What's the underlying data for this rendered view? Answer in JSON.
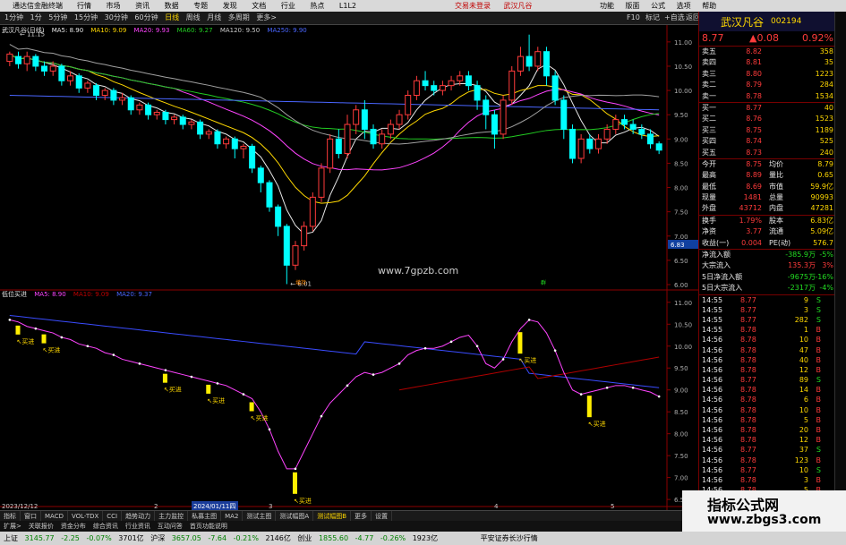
{
  "titlebar": {
    "app_name": "通达信金融终端",
    "menu": [
      "行情",
      "市场",
      "资讯",
      "数据",
      "专题",
      "发现",
      "文档",
      "行业",
      "热点",
      "L1L2"
    ],
    "center_links": [
      "交易未登录",
      "武汉凡谷"
    ],
    "right_items": [
      "功能",
      "版面",
      "公式",
      "选项",
      "帮助"
    ]
  },
  "toolbar": {
    "periods": [
      "1分钟",
      "1分",
      "5分钟",
      "15分钟",
      "30分钟",
      "60分钟",
      "日线",
      "周线",
      "月线",
      "多周期",
      "更多>"
    ],
    "selected": "日线",
    "right_items": [
      "F10",
      "标记",
      "+自选",
      "返回"
    ]
  },
  "main_chart": {
    "title": "武汉凡谷(日线)",
    "legend": [
      {
        "text": "MA5: 8.90",
        "color": "#e8e8e8"
      },
      {
        "text": "MA10: 9.09",
        "color": "#ffd800"
      },
      {
        "text": "MA20: 9.93",
        "color": "#ff44ff"
      },
      {
        "text": "MA60: 9.27",
        "color": "#22cc22"
      },
      {
        "text": "MA120: 9.50",
        "color": "#cccccc"
      },
      {
        "text": "MA250: 9.90",
        "color": "#4a66ff"
      }
    ],
    "y_ticks": [
      "11.00",
      "10.50",
      "10.00",
      "9.50",
      "9.00",
      "8.50",
      "8.00",
      "7.50",
      "7.00",
      "6.50",
      "6.00"
    ],
    "price_tag": "6.83",
    "high_label": "11.15",
    "low_label": "6.01",
    "watermark": "www.7gpzb.com",
    "marker_a": "增持",
    "marker_b": "群"
  },
  "sub_chart": {
    "title": "低位买进",
    "legend": [
      {
        "text": "MA5: 8.90",
        "color": "#ff44ff"
      },
      {
        "text": "MA10: 9.09",
        "color": "#c00000"
      },
      {
        "text": "MA20: 9.37",
        "color": "#4a66ff"
      }
    ],
    "y_ticks": [
      "11.00",
      "10.50",
      "10.00",
      "9.50",
      "9.00",
      "8.50",
      "8.00",
      "7.50",
      "7.00",
      "6.50"
    ],
    "signal_label": "买进",
    "signals_count": 8
  },
  "x_axis": {
    "left_date": "2023/12/12",
    "selected_date": "2024/01/11四",
    "ticks": [
      "2",
      "3",
      "4",
      "5"
    ]
  },
  "quote": {
    "name": "武汉凡谷",
    "code": "002194",
    "price": "8.77",
    "change": "▲0.08",
    "pct": "0.92%",
    "asks": [
      {
        "label": "卖五",
        "price": "8.82",
        "vol": "358"
      },
      {
        "label": "卖四",
        "price": "8.81",
        "vol": "35"
      },
      {
        "label": "卖三",
        "price": "8.80",
        "vol": "1223"
      },
      {
        "label": "卖二",
        "price": "8.79",
        "vol": "284"
      },
      {
        "label": "卖一",
        "price": "8.78",
        "vol": "1534"
      }
    ],
    "bids": [
      {
        "label": "买一",
        "price": "8.77",
        "vol": "40"
      },
      {
        "label": "买二",
        "price": "8.76",
        "vol": "1523"
      },
      {
        "label": "买三",
        "price": "8.75",
        "vol": "1189"
      },
      {
        "label": "买四",
        "price": "8.74",
        "vol": "525"
      },
      {
        "label": "买五",
        "price": "8.73",
        "vol": "240"
      }
    ],
    "stats": [
      {
        "k1": "今开",
        "v1": "8.75",
        "k2": "均价",
        "v2": "8.79"
      },
      {
        "k1": "最高",
        "v1": "8.89",
        "k2": "量比",
        "v2": "0.65"
      },
      {
        "k1": "最低",
        "v1": "8.69",
        "k2": "市值",
        "v2": "59.9亿"
      },
      {
        "k1": "现量",
        "v1": "1481",
        "k2": "总量",
        "v2": "90993"
      },
      {
        "k1": "外盘",
        "v1": "43712",
        "k2": "内盘",
        "v2": "47281"
      }
    ],
    "stats2": [
      {
        "k1": "换手",
        "v1": "1.79%",
        "k2": "股本",
        "v2": "6.83亿"
      },
      {
        "k1": "净资",
        "v1": "3.77",
        "k2": "流通",
        "v2": "5.09亿"
      },
      {
        "k1": "收益(一)",
        "v1": "0.004",
        "k2": "PE(动)",
        "v2": "576.7"
      }
    ],
    "flows": [
      {
        "label": "净流入额",
        "value": "-385.9万",
        "pct": "-5%"
      },
      {
        "label": "大宗流入",
        "value": "135.3万",
        "pct": "3%"
      },
      {
        "label": "5日净流入额",
        "value": "-9675万",
        "pct": "-16%"
      },
      {
        "label": "5日大宗流入",
        "value": "-2317万",
        "pct": "-4%"
      }
    ],
    "ticks": [
      {
        "t": "14:55",
        "p": "8.77",
        "v": "9",
        "s": "S"
      },
      {
        "t": "14:55",
        "p": "8.77",
        "v": "3",
        "s": "S"
      },
      {
        "t": "14:55",
        "p": "8.77",
        "v": "282",
        "s": "S"
      },
      {
        "t": "14:55",
        "p": "8.78",
        "v": "1",
        "s": "B"
      },
      {
        "t": "14:56",
        "p": "8.78",
        "v": "10",
        "s": "B"
      },
      {
        "t": "14:56",
        "p": "8.78",
        "v": "47",
        "s": "B"
      },
      {
        "t": "14:56",
        "p": "8.78",
        "v": "40",
        "s": "B"
      },
      {
        "t": "14:56",
        "p": "8.78",
        "v": "12",
        "s": "B"
      },
      {
        "t": "14:56",
        "p": "8.77",
        "v": "89",
        "s": "S"
      },
      {
        "t": "14:56",
        "p": "8.78",
        "v": "14",
        "s": "B"
      },
      {
        "t": "14:56",
        "p": "8.78",
        "v": "6",
        "s": "B"
      },
      {
        "t": "14:56",
        "p": "8.78",
        "v": "10",
        "s": "B"
      },
      {
        "t": "14:56",
        "p": "8.78",
        "v": "5",
        "s": "B"
      },
      {
        "t": "14:56",
        "p": "8.78",
        "v": "20",
        "s": "B"
      },
      {
        "t": "14:56",
        "p": "8.78",
        "v": "12",
        "s": "B"
      },
      {
        "t": "14:56",
        "p": "8.77",
        "v": "37",
        "s": "S"
      },
      {
        "t": "14:56",
        "p": "8.78",
        "v": "123",
        "s": "B"
      },
      {
        "t": "14:56",
        "p": "8.77",
        "v": "10",
        "s": "S"
      },
      {
        "t": "14:56",
        "p": "8.78",
        "v": "3",
        "s": "B"
      },
      {
        "t": "14:56",
        "p": "8.78",
        "v": "5",
        "s": "B"
      }
    ]
  },
  "tabbar": {
    "items": [
      "指标",
      "窗口",
      "MACD",
      "VOL-TDX",
      "CCI",
      "趋势动力",
      "主力监控",
      "私募主图",
      "MA2",
      "测试主图",
      "测试幅图A",
      "测试幅图B",
      "更多",
      "设置"
    ],
    "selected": "测试幅图B"
  },
  "indexbar": {
    "items": [
      "扩展>",
      "关联报价",
      "资金分布",
      "综合资讯",
      "行业资讯",
      "互动问答",
      "首页功能说明"
    ]
  },
  "status": {
    "sh_label": "上证",
    "sh_val": "3145.77",
    "sh_chg": "-2.25",
    "sh_pct": "-0.07%",
    "sh_amt": "3701亿",
    "sz_label": "沪深",
    "sz_val": "3657.05",
    "sz_chg": "-7.64",
    "sz_pct": "-0.21%",
    "sz_amt": "2146亿",
    "cy_label": "创业",
    "cy_val": "1855.60",
    "cy_chg": "-4.77",
    "cy_pct": "-0.26%",
    "cy_amt": "1923亿",
    "broker": "平安证券长沙行情"
  },
  "badge": {
    "title": "指标公式网",
    "url": "www.zbgs3.com"
  },
  "chart_data": {
    "type": "candlestick",
    "title": "武汉凡谷(日线)",
    "ylim": [
      6.0,
      11.2
    ],
    "candles": [
      [
        10.6,
        10.75,
        10.5,
        10.8
      ],
      [
        10.7,
        10.55,
        10.45,
        10.8
      ],
      [
        10.55,
        10.7,
        10.4,
        10.8
      ],
      [
        10.7,
        10.5,
        10.4,
        10.75
      ],
      [
        10.5,
        10.4,
        10.3,
        10.6
      ],
      [
        10.4,
        10.5,
        10.3,
        10.6
      ],
      [
        10.5,
        10.2,
        10.1,
        10.55
      ],
      [
        10.2,
        10.3,
        10.1,
        10.4
      ],
      [
        10.3,
        10.05,
        9.95,
        10.35
      ],
      [
        10.05,
        10.15,
        9.95,
        10.2
      ],
      [
        10.1,
        9.9,
        9.8,
        10.15
      ],
      [
        9.9,
        10.0,
        9.8,
        10.05
      ],
      [
        10.0,
        9.8,
        9.7,
        10.05
      ],
      [
        9.8,
        9.85,
        9.7,
        9.95
      ],
      [
        9.85,
        9.6,
        9.5,
        9.9
      ],
      [
        9.6,
        9.7,
        9.5,
        9.75
      ],
      [
        9.7,
        9.5,
        9.4,
        9.75
      ],
      [
        9.5,
        9.55,
        9.4,
        9.6
      ],
      [
        9.55,
        9.4,
        9.3,
        9.6
      ],
      [
        9.4,
        9.45,
        9.3,
        9.5
      ],
      [
        9.45,
        9.3,
        9.2,
        9.5
      ],
      [
        9.3,
        9.35,
        9.2,
        9.4
      ],
      [
        9.35,
        9.1,
        9.0,
        9.4
      ],
      [
        9.1,
        9.15,
        9.0,
        9.2
      ],
      [
        9.15,
        8.9,
        8.8,
        9.2
      ],
      [
        8.9,
        9.0,
        8.8,
        9.05
      ],
      [
        9.0,
        8.8,
        8.6,
        9.05
      ],
      [
        8.8,
        8.85,
        8.6,
        8.9
      ],
      [
        8.85,
        8.4,
        8.3,
        8.9
      ],
      [
        8.4,
        8.1,
        7.9,
        8.45
      ],
      [
        8.1,
        7.6,
        7.5,
        8.15
      ],
      [
        7.6,
        7.2,
        7.0,
        7.65
      ],
      [
        7.2,
        6.4,
        6.01,
        7.25
      ],
      [
        6.4,
        6.8,
        6.3,
        6.9
      ],
      [
        6.8,
        7.2,
        6.7,
        7.3
      ],
      [
        7.2,
        7.8,
        7.1,
        7.9
      ],
      [
        7.8,
        8.4,
        7.7,
        8.5
      ],
      [
        8.4,
        9.0,
        8.3,
        9.1
      ],
      [
        9.0,
        8.7,
        8.6,
        9.2
      ],
      [
        8.7,
        9.3,
        8.6,
        9.5
      ],
      [
        9.3,
        9.6,
        9.1,
        9.7
      ],
      [
        9.6,
        9.2,
        9.0,
        9.8
      ],
      [
        9.2,
        8.9,
        8.8,
        9.3
      ],
      [
        8.9,
        9.1,
        8.8,
        9.2
      ],
      [
        9.1,
        9.3,
        9.0,
        9.4
      ],
      [
        9.3,
        9.5,
        9.2,
        9.6
      ],
      [
        9.5,
        9.9,
        9.4,
        10.0
      ],
      [
        9.9,
        10.2,
        9.8,
        10.3
      ],
      [
        10.2,
        10.1,
        10.0,
        10.4
      ],
      [
        10.1,
        10.0,
        9.9,
        10.2
      ],
      [
        10.0,
        10.1,
        9.9,
        10.2
      ],
      [
        10.1,
        10.2,
        10.0,
        10.3
      ],
      [
        10.2,
        10.3,
        10.1,
        10.4
      ],
      [
        10.3,
        10.1,
        10.0,
        10.4
      ],
      [
        10.1,
        9.8,
        9.6,
        10.2
      ],
      [
        9.8,
        9.5,
        9.2,
        9.9
      ],
      [
        9.5,
        9.1,
        8.8,
        9.6
      ],
      [
        9.1,
        9.8,
        9.0,
        9.9
      ],
      [
        9.8,
        10.4,
        9.7,
        10.5
      ],
      [
        10.4,
        10.7,
        10.3,
        10.9
      ],
      [
        10.7,
        10.5,
        10.4,
        11.15
      ],
      [
        10.5,
        10.8,
        10.4,
        10.9
      ],
      [
        10.8,
        10.3,
        10.1,
        10.9
      ],
      [
        10.3,
        9.8,
        9.7,
        10.4
      ],
      [
        9.8,
        9.2,
        9.0,
        9.9
      ],
      [
        9.2,
        8.6,
        8.5,
        9.3
      ],
      [
        8.6,
        9.0,
        8.5,
        9.1
      ],
      [
        9.0,
        8.8,
        8.7,
        9.1
      ],
      [
        8.8,
        9.0,
        8.7,
        9.1
      ],
      [
        9.0,
        9.2,
        8.9,
        9.3
      ],
      [
        9.2,
        9.4,
        9.1,
        9.5
      ],
      [
        9.4,
        9.3,
        9.2,
        9.5
      ],
      [
        9.3,
        9.2,
        9.1,
        9.4
      ],
      [
        9.2,
        9.1,
        9.0,
        9.3
      ],
      [
        9.1,
        8.9,
        8.8,
        9.2
      ],
      [
        8.9,
        8.77,
        8.69,
        8.95
      ]
    ],
    "osc": [
      10.6,
      10.55,
      10.45,
      10.4,
      10.35,
      10.3,
      10.2,
      10.15,
      10.05,
      10.0,
      9.95,
      9.85,
      9.8,
      9.7,
      9.65,
      9.6,
      9.55,
      9.5,
      9.45,
      9.4,
      9.35,
      9.3,
      9.25,
      9.2,
      9.15,
      9.1,
      9.0,
      8.9,
      8.8,
      8.5,
      8.1,
      7.6,
      7.2,
      7.2,
      7.6,
      8.0,
      8.4,
      8.7,
      8.9,
      9.1,
      9.3,
      9.4,
      9.35,
      9.4,
      9.5,
      9.6,
      9.8,
      9.9,
      9.95,
      9.95,
      10.0,
      10.1,
      10.2,
      10.25,
      10.0,
      9.6,
      9.5,
      9.7,
      10.1,
      10.4,
      10.6,
      10.55,
      10.3,
      9.9,
      9.4,
      9.0,
      8.9,
      8.95,
      9.0,
      9.05,
      9.1,
      9.1,
      9.05,
      9.0,
      8.95,
      8.85
    ],
    "signals": [
      1,
      4,
      18,
      23,
      28,
      33,
      59,
      67
    ]
  }
}
